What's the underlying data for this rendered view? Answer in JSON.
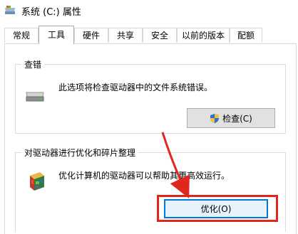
{
  "window": {
    "title": "系统 (C:) 属性"
  },
  "tabs": [
    {
      "label": "常规"
    },
    {
      "label": "工具",
      "active": true
    },
    {
      "label": "硬件"
    },
    {
      "label": "共享"
    },
    {
      "label": "安全"
    },
    {
      "label": "以前的版本"
    },
    {
      "label": "配额"
    }
  ],
  "error_check": {
    "title": "查错",
    "description": "此选项将检查驱动器中的文件系统错误。",
    "button": "检查(C)",
    "icon": "drive-icon",
    "button_icon": "uac-shield-icon"
  },
  "optimize": {
    "title": "对驱动器进行优化和碎片整理",
    "description": "优化计算机的驱动器可以帮助其更高效运行。",
    "button": "优化(O)",
    "icon": "defrag-icon"
  },
  "colors": {
    "accent": "#0078d7",
    "annotation": "#e0271e"
  }
}
